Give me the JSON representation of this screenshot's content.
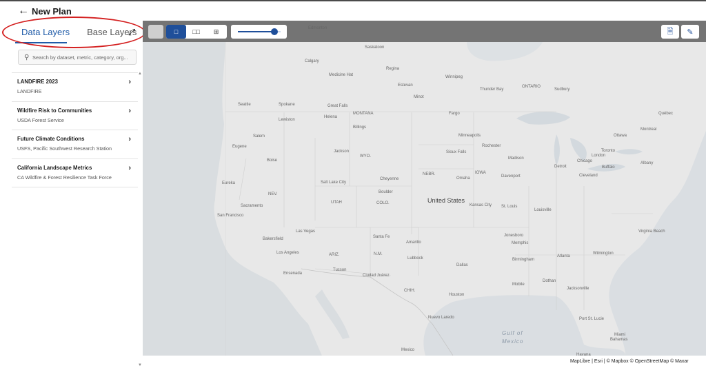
{
  "header": {
    "back_icon": "arrow-left-icon",
    "title": "New Plan"
  },
  "sidebar": {
    "tabs": [
      {
        "label": "Data Layers",
        "active": true
      },
      {
        "label": "Base Layers",
        "active": false
      }
    ],
    "collapse_icon": "collapse-arrows-icon",
    "search": {
      "placeholder": "Search by dataset, metric, category, org..."
    },
    "layers": [
      {
        "name": "LANDFIRE 2023",
        "source": "LANDFIRE"
      },
      {
        "name": "Wildfire Risk to Communities",
        "source": "USDA Forest Service"
      },
      {
        "name": "Future Climate Conditions",
        "source": "USFS, Pacific Southwest Research Station"
      },
      {
        "name": "California Landscape Metrics",
        "source": "CA Wildfire & Forest Resilience Task Force"
      }
    ]
  },
  "map_toolbar": {
    "view_modes": [
      "single-view-icon",
      "two-view-icon",
      "four-view-icon"
    ],
    "active_view": 0,
    "opacity": 0.85,
    "tools": [
      "upload-file-icon",
      "draw-pen-icon"
    ]
  },
  "map": {
    "labels": [
      {
        "t": "Edmonton"
      },
      {
        "t": "Calgary"
      },
      {
        "t": "Saskatoon"
      },
      {
        "t": "Regina"
      },
      {
        "t": "Winnipeg"
      },
      {
        "t": "Medicine Hat"
      },
      {
        "t": "Estevan"
      },
      {
        "t": "Seattle"
      },
      {
        "t": "Spokane"
      },
      {
        "t": "Great Falls"
      },
      {
        "t": "MONTANA"
      },
      {
        "t": "Helena"
      },
      {
        "t": "Lewiston"
      },
      {
        "t": "Billings"
      },
      {
        "t": "Minot"
      },
      {
        "t": "Fargo"
      },
      {
        "t": "Minneapolis"
      },
      {
        "t": "Salem"
      },
      {
        "t": "Eugene"
      },
      {
        "t": "Boise"
      },
      {
        "t": "Jackson"
      },
      {
        "t": "WYO."
      },
      {
        "t": "Sioux Falls"
      },
      {
        "t": "NEBR."
      },
      {
        "t": "Omaha"
      },
      {
        "t": "IOWA"
      },
      {
        "t": "Cheyenne"
      },
      {
        "t": "Salt Lake City"
      },
      {
        "t": "Boulder"
      },
      {
        "t": "COLO."
      },
      {
        "t": "NEV."
      },
      {
        "t": "UTAH"
      },
      {
        "t": "Eureka"
      },
      {
        "t": "Sacramento"
      },
      {
        "t": "San Francisco"
      },
      {
        "t": "Las Vegas"
      },
      {
        "t": "Bakersfield"
      },
      {
        "t": "Los Angeles"
      },
      {
        "t": "Ensenada"
      },
      {
        "t": "ARIZ."
      },
      {
        "t": "Tucson"
      },
      {
        "t": "Santa Fe"
      },
      {
        "t": "N.M."
      },
      {
        "t": "Amarillo"
      },
      {
        "t": "Lubbock"
      },
      {
        "t": "Ciudad Juárez"
      },
      {
        "t": "CHIH."
      },
      {
        "t": "Dallas"
      },
      {
        "t": "Houston"
      },
      {
        "t": "Kansas City"
      },
      {
        "t": "St. Louis"
      },
      {
        "t": "Rochester"
      },
      {
        "t": "Madison"
      },
      {
        "t": "Detroit"
      },
      {
        "t": "Chicago"
      },
      {
        "t": "Cleveland"
      },
      {
        "t": "Toronto"
      },
      {
        "t": "Ottawa"
      },
      {
        "t": "Montreal"
      },
      {
        "t": "Québec"
      },
      {
        "t": "Albany"
      },
      {
        "t": "Buffalo"
      },
      {
        "t": "Louisville"
      },
      {
        "t": "Memphis"
      },
      {
        "t": "Jonesboro"
      },
      {
        "t": "Atlanta"
      },
      {
        "t": "Birmingham"
      },
      {
        "t": "Mobile"
      },
      {
        "t": "Dothan"
      },
      {
        "t": "Jacksonville"
      },
      {
        "t": "Wilmington"
      },
      {
        "t": "Virginia Beach"
      },
      {
        "t": "Port St. Lucie"
      },
      {
        "t": "Miami"
      },
      {
        "t": "Bahamas"
      },
      {
        "t": "Havana"
      },
      {
        "t": "Nuevo Laredo"
      },
      {
        "t": "Mexico"
      },
      {
        "t": "ONTARIO"
      },
      {
        "t": "Davenport"
      },
      {
        "t": "Sudbury"
      },
      {
        "t": "Thunder Bay"
      },
      {
        "t": "London"
      }
    ],
    "country_label": "United States",
    "water_label_line1": "Gulf of",
    "water_label_line2": "Mexico",
    "attribution": "MapLibre | Esri | © Mapbox © OpenStreetMap  © Maxar"
  }
}
